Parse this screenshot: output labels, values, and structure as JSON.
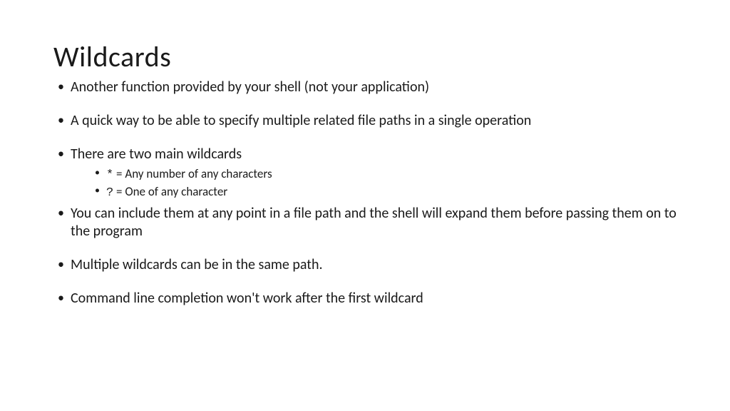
{
  "title": "Wildcards",
  "bullets": {
    "b1": "Another function provided by your shell (not your application)",
    "b2": "A quick way to be able to specify multiple related file paths in a single operation",
    "b3": "There are two main wildcards",
    "b3_sub": {
      "s1_code": "*",
      "s1_text": " = Any number of any characters",
      "s2_code": "?",
      "s2_text": " = One of any character"
    },
    "b4": "You can include them at any point in a file path and the shell will expand them before passing them on to the program",
    "b5": "Multiple wildcards can be in the same path.",
    "b6": "Command line completion won't work after the first wildcard"
  }
}
